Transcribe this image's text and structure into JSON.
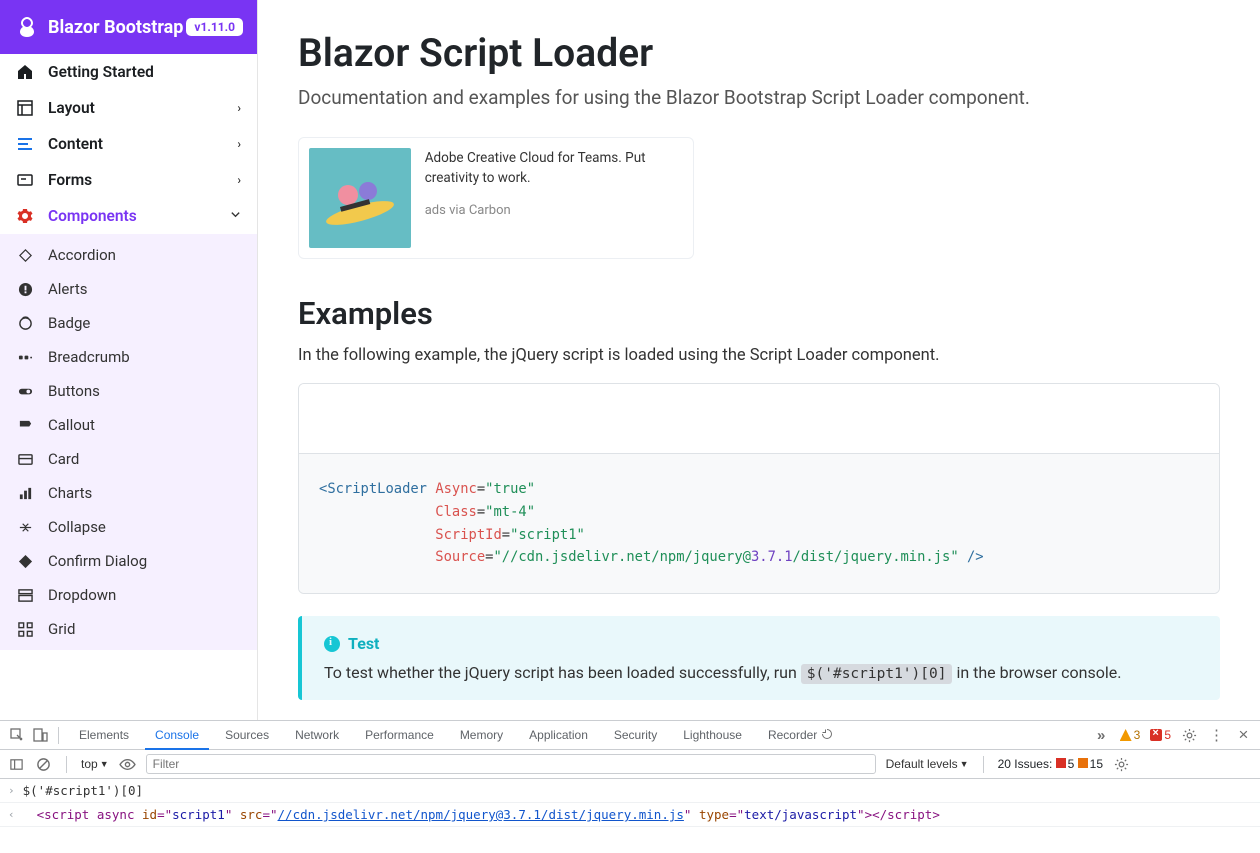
{
  "brand": {
    "name": "Blazor Bootstrap",
    "version": "v1.11.0"
  },
  "sidebar": {
    "top": [
      {
        "label": "Getting Started",
        "icon": "home"
      },
      {
        "label": "Layout",
        "icon": "layout",
        "expand": true
      },
      {
        "label": "Content",
        "icon": "content",
        "expand": true
      },
      {
        "label": "Forms",
        "icon": "forms",
        "expand": true
      },
      {
        "label": "Components",
        "icon": "gear",
        "expand": true,
        "active": true
      }
    ],
    "components": [
      {
        "label": "Accordion",
        "icon": "accordion"
      },
      {
        "label": "Alerts",
        "icon": "alerts"
      },
      {
        "label": "Badge",
        "icon": "badge"
      },
      {
        "label": "Breadcrumb",
        "icon": "breadcrumb"
      },
      {
        "label": "Buttons",
        "icon": "buttons"
      },
      {
        "label": "Callout",
        "icon": "callout"
      },
      {
        "label": "Card",
        "icon": "card"
      },
      {
        "label": "Charts",
        "icon": "charts"
      },
      {
        "label": "Collapse",
        "icon": "collapse"
      },
      {
        "label": "Confirm Dialog",
        "icon": "confirm"
      },
      {
        "label": "Dropdown",
        "icon": "dropdown"
      },
      {
        "label": "Grid",
        "icon": "grid"
      }
    ]
  },
  "page": {
    "title": "Blazor Script Loader",
    "subtitle": "Documentation and examples for using the Blazor Bootstrap Script Loader component."
  },
  "ad": {
    "text": "Adobe Creative Cloud for Teams. Put creativity to work.",
    "via": "ads via Carbon"
  },
  "examples": {
    "heading": "Examples",
    "intro": "In the following example, the jQuery script is loaded using the Script Loader component."
  },
  "code": {
    "tag": "ScriptLoader",
    "async_attr": "Async",
    "async_val": "true",
    "class_attr": "Class",
    "class_val": "mt-4",
    "scriptid_attr": "ScriptId",
    "scriptid_val": "script1",
    "source_attr": "Source",
    "source_pre": "//cdn.jsdelivr.net/npm/jquery@",
    "source_ver": "3.7.1",
    "source_post": "/dist/jquery.min.js"
  },
  "callout": {
    "title": "Test",
    "body_pre": "To test whether the jQuery script has been loaded successfully, run ",
    "code": "$('#script1')[0]",
    "body_post": " in the browser console."
  },
  "devtools": {
    "tabs": [
      "Elements",
      "Console",
      "Sources",
      "Network",
      "Performance",
      "Memory",
      "Application",
      "Security",
      "Lighthouse",
      "Recorder"
    ],
    "active_tab": "Console",
    "warn_count": "3",
    "err_count": "5",
    "toolbar": {
      "context": "top",
      "filter_placeholder": "Filter",
      "levels": "Default levels",
      "issues_label": "20 Issues:",
      "issues_err": "5",
      "issues_warn": "15"
    },
    "console": {
      "cmd": "$('#script1')[0]",
      "result": {
        "open_tag_a": "<",
        "tag": "script",
        "text1": " async ",
        "attr_id": "id",
        "val_id": "script1",
        "attr_src": "src",
        "val_src": "//cdn.jsdelivr.net/npm/jquery@3.7.1/dist/jquery.min.js",
        "attr_type": "type",
        "val_type": "text/javascript",
        "close1": ">",
        "close2": "</",
        "close3": ">"
      }
    }
  }
}
